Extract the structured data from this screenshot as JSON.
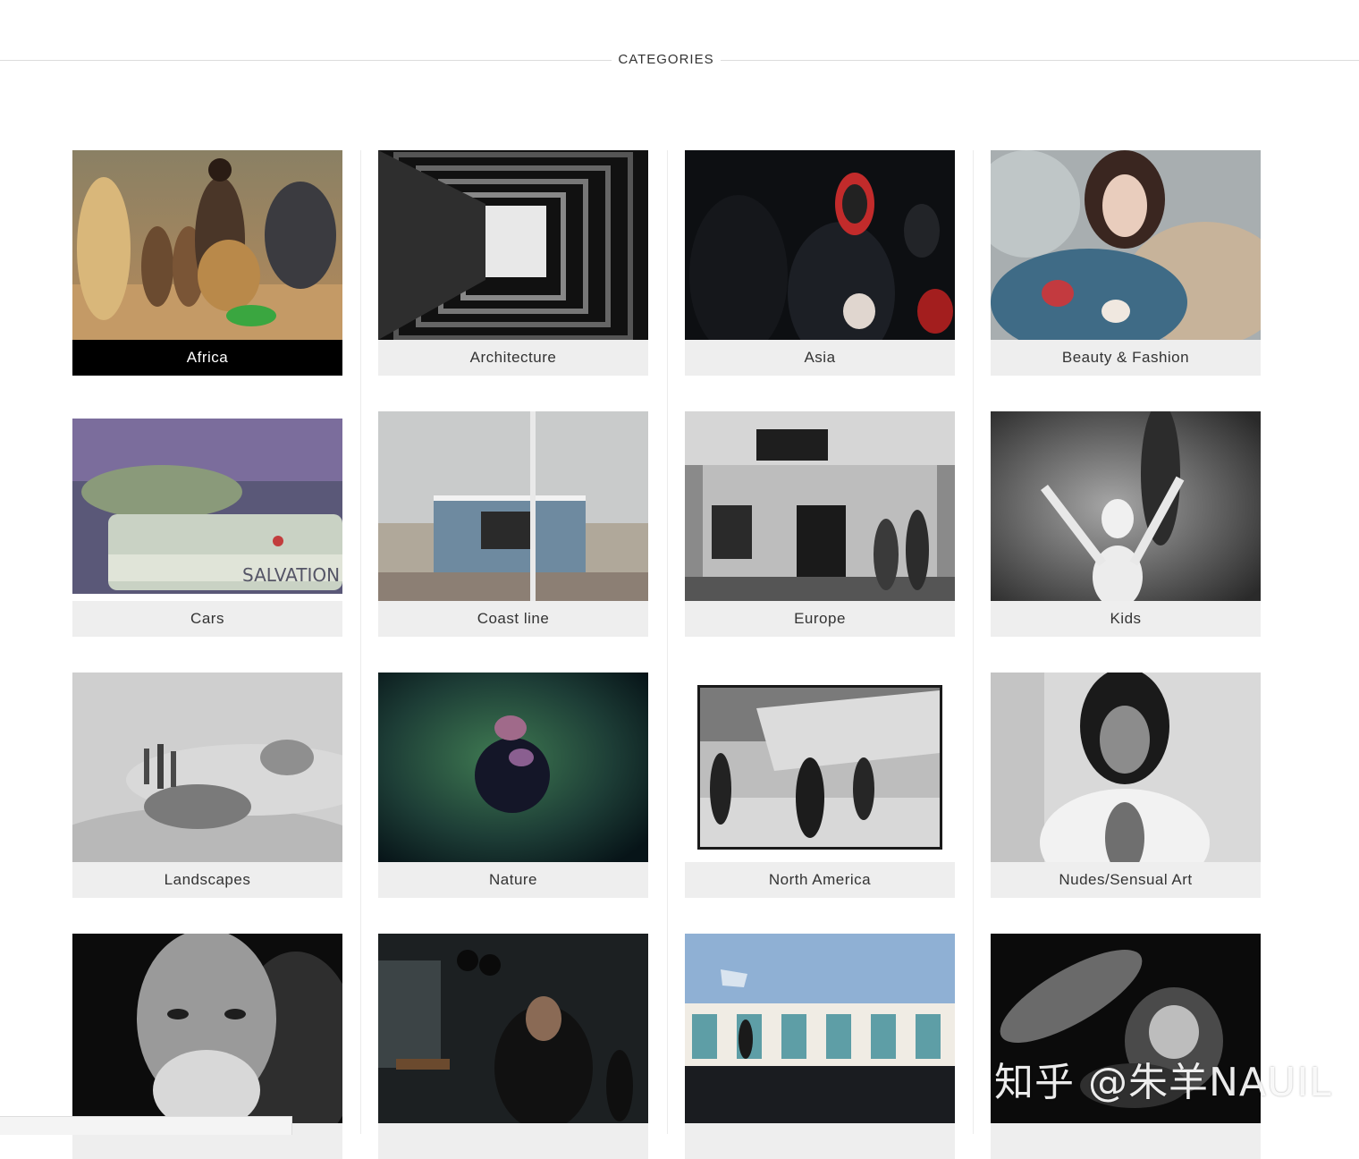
{
  "section": {
    "title": "CATEGORIES"
  },
  "categories": [
    {
      "label": "Africa"
    },
    {
      "label": "Architecture"
    },
    {
      "label": "Asia"
    },
    {
      "label": "Beauty & Fashion"
    },
    {
      "label": "Cars"
    },
    {
      "label": "Coast line"
    },
    {
      "label": "Europe"
    },
    {
      "label": "Kids"
    },
    {
      "label": "Landscapes"
    },
    {
      "label": "Nature"
    },
    {
      "label": "North America"
    },
    {
      "label": "Nudes/Sensual Art"
    },
    {
      "label": ""
    },
    {
      "label": ""
    },
    {
      "label": ""
    },
    {
      "label": ""
    }
  ],
  "watermark": {
    "text": "知乎 @朱羊NAUIL"
  },
  "colors": {
    "caption_bg": "#eeeeee",
    "caption_active_bg": "#000000",
    "caption_text": "#333333"
  }
}
